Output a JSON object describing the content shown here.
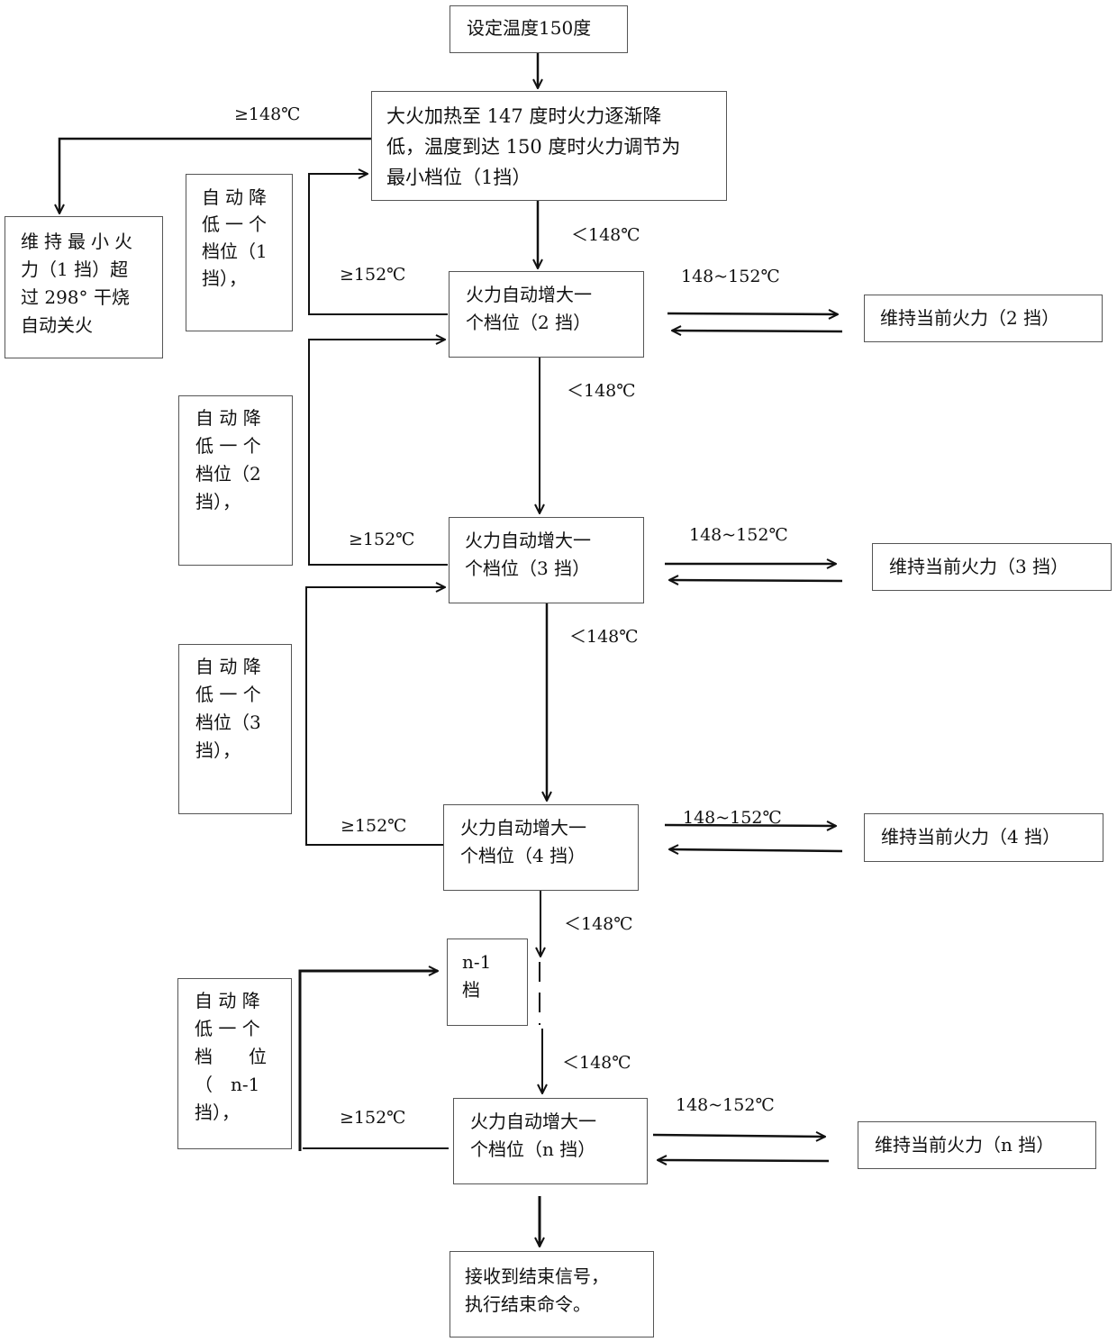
{
  "nodes": {
    "start": "设定温度150度",
    "heat": [
      "大火加热至 147 度时火力逐渐降",
      "低，温度到达 150 度时火力调节为",
      "最小档位（1挡）"
    ],
    "dry_burn": [
      "维持最小火",
      "力（1 挡）超",
      "过 298° 干烧",
      "自动关火"
    ],
    "dec1": [
      "自动降",
      "低一个",
      "档位（1",
      "挡），"
    ],
    "inc2": [
      "火力自动增大一",
      "个档位（2 挡）"
    ],
    "keep2": "维持当前火力（2 挡）",
    "dec2": [
      "自 动 降",
      "低 一 个",
      "档位（2",
      "挡），"
    ],
    "inc3": [
      "火力自动增大一",
      "个档位（3 挡）"
    ],
    "keep3": "维持当前火力（3 挡）",
    "dec3": [
      "自 动 降",
      "低 一 个",
      "档位（3",
      "挡），"
    ],
    "inc4": [
      "火力自动增大一",
      "个档位（4 挡）"
    ],
    "keep4": "维持当前火力（4 挡）",
    "n1": [
      "n-1",
      "档"
    ],
    "decn1": [
      "自 动 降",
      "低 一 个",
      "档　　位",
      "（　n-1",
      "挡），"
    ],
    "incn": [
      "火力自动增大一",
      "个档位（n 挡）"
    ],
    "keepn": "维持当前火力（n 挡）",
    "end": [
      "接收到结束信号，",
      "执行结束命令。"
    ]
  },
  "labels": {
    "ge148": "≥148℃",
    "lt148": "＜148℃",
    "ge152": "≥152℃",
    "range": "148~152℃"
  }
}
